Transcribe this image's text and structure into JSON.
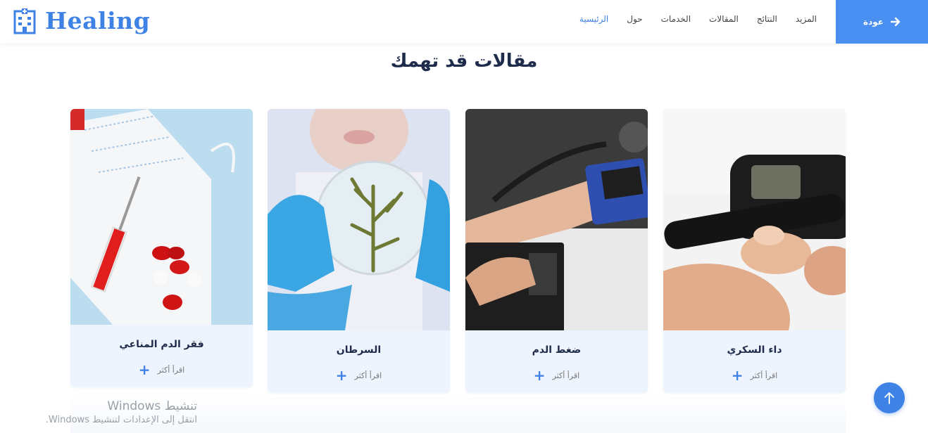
{
  "header": {
    "logo_text": "Healing",
    "nav": [
      {
        "label": "الرئيسية",
        "active": true
      },
      {
        "label": "حول",
        "active": false
      },
      {
        "label": "الخدمات",
        "active": false
      },
      {
        "label": "المقالات",
        "active": false
      },
      {
        "label": "النتائج",
        "active": false
      },
      {
        "label": "المزيد",
        "active": false
      }
    ],
    "back_label": "عودة"
  },
  "section": {
    "title": "مقالات قد تهمك"
  },
  "cards": [
    {
      "title": "داء السكري",
      "read_more": "اقرأ أكثر",
      "image": "glucose-meter-photo"
    },
    {
      "title": "ضغط الدم",
      "read_more": "اقرأ أكثر",
      "image": "blood-pressure-cuff-photo"
    },
    {
      "title": "السرطان",
      "read_more": "اقرأ أكثر",
      "image": "petri-dish-photo"
    },
    {
      "title": "فقر الدم المناعي",
      "read_more": "اقرأ أكثر",
      "image": "syringe-mask-pills-photo"
    }
  ],
  "watermark": {
    "line1": "تنشيط Windows",
    "line2": "انتقل إلى الإعدادات لتنشيط Windows."
  },
  "colors": {
    "accent": "#3f82e6",
    "card_bg": "#eef4fd",
    "title": "#1e2b4a"
  }
}
